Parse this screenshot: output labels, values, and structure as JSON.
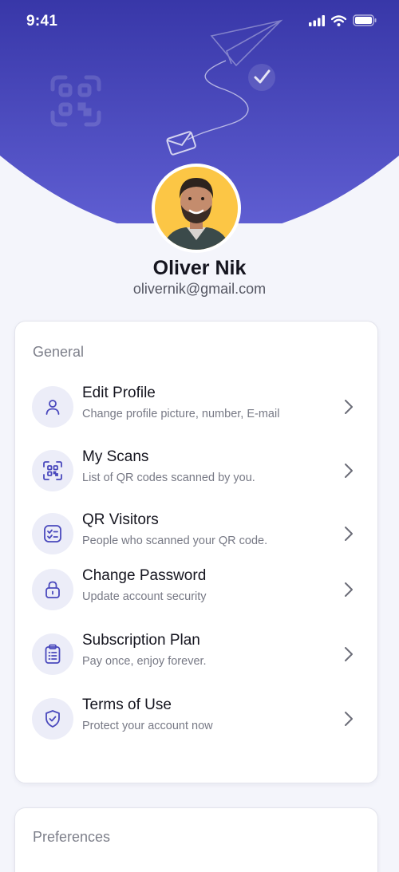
{
  "status": {
    "time": "9:41"
  },
  "profile": {
    "name": "Oliver Nik",
    "email": "olivernik@gmail.com"
  },
  "general": {
    "title": "General",
    "items": [
      {
        "title": "Edit Profile",
        "subtitle": "Change profile picture, number, E-mail",
        "icon": "user-icon"
      },
      {
        "title": "My Scans",
        "subtitle": "List of QR codes scanned by you.",
        "icon": "qr-scan-icon"
      },
      {
        "title": "QR Visitors",
        "subtitle": "People who scanned your QR code.",
        "icon": "checklist-icon"
      },
      {
        "title": "Change Password",
        "subtitle": "Update account security",
        "icon": "lock-icon"
      },
      {
        "title": "Subscription Plan",
        "subtitle": "Pay once, enjoy forever.",
        "icon": "clipboard-icon"
      },
      {
        "title": "Terms of Use",
        "subtitle": "Protect your account now",
        "icon": "shield-check-icon"
      }
    ]
  },
  "preferences": {
    "title": "Preferences"
  },
  "colors": {
    "accent": "#4a49bd",
    "hero_top": "#3b3aab",
    "hero_bottom": "#5d5cd0",
    "icon_bg": "#ecedf8"
  }
}
